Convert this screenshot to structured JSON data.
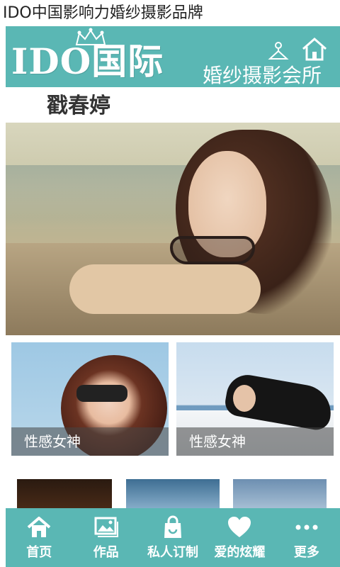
{
  "page_heading": "IDO中国影响力婚纱摄影品牌",
  "brand": {
    "logo_text": "IDO国际",
    "slogan": "婚纱摄影会所",
    "crown_icon": "crown-icon",
    "hanger_icon": "hanger-icon",
    "home_icon": "home-icon",
    "color": "#5ab7b4"
  },
  "model_name": "戳春婷",
  "gallery": {
    "tiles": [
      {
        "caption": "性感女神"
      },
      {
        "caption": "性感女神"
      }
    ]
  },
  "nav": {
    "items": [
      {
        "label": "首页",
        "icon": "home-icon"
      },
      {
        "label": "作品",
        "icon": "photos-icon"
      },
      {
        "label": "私人订制",
        "icon": "shopping-bag-icon"
      },
      {
        "label": "爱的炫耀",
        "icon": "heart-icon"
      },
      {
        "label": "更多",
        "icon": "more-icon"
      }
    ]
  }
}
